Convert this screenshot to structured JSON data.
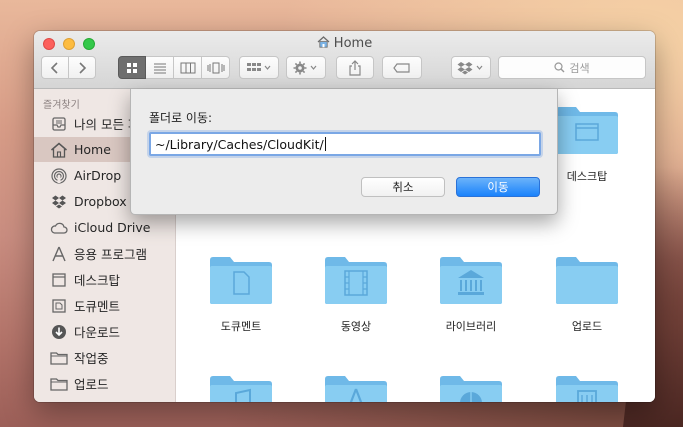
{
  "window": {
    "title": "Home"
  },
  "toolbar": {
    "search_placeholder": "검색",
    "icons": [
      "back-icon",
      "forward-icon",
      "icon-view-icon",
      "list-view-icon",
      "column-view-icon",
      "coverflow-view-icon",
      "arrange-icon",
      "action-gear-icon",
      "share-icon",
      "tag-icon",
      "dropbox-icon",
      "search-icon"
    ]
  },
  "sidebar": {
    "header": "즐겨찾기",
    "items": [
      {
        "label": "나의 모든 파일",
        "icon": "all-files-icon"
      },
      {
        "label": "Home",
        "icon": "home-icon",
        "selected": true
      },
      {
        "label": "AirDrop",
        "icon": "airdrop-icon"
      },
      {
        "label": "Dropbox",
        "icon": "dropbox-icon"
      },
      {
        "label": "iCloud Drive",
        "icon": "cloud-icon"
      },
      {
        "label": "응용 프로그램",
        "icon": "applications-icon"
      },
      {
        "label": "데스크탑",
        "icon": "desktop-icon"
      },
      {
        "label": "도큐멘트",
        "icon": "document-icon"
      },
      {
        "label": "다운로드",
        "icon": "download-icon"
      },
      {
        "label": "작업중",
        "icon": "folder-icon"
      },
      {
        "label": "업로드",
        "icon": "folder-icon"
      }
    ]
  },
  "folders": [
    {
      "label": "데스크탑",
      "icon": "desktop-folder-icon"
    },
    {
      "label": "도큐멘트",
      "icon": "documents-folder-icon"
    },
    {
      "label": "동영상",
      "icon": "movies-folder-icon"
    },
    {
      "label": "라이브러리",
      "icon": "library-folder-icon"
    },
    {
      "label": "업로드",
      "icon": "folder-icon"
    },
    {
      "label": "",
      "icon": "music-folder-icon"
    },
    {
      "label": "",
      "icon": "applications-folder-icon"
    },
    {
      "label": "",
      "icon": "public-folder-icon"
    },
    {
      "label": "",
      "icon": "sites-folder-icon"
    }
  ],
  "dialog": {
    "label": "폴더로 이동:",
    "path_value": "~/Library/Caches/CloudKit/",
    "cancel_label": "취소",
    "go_label": "이동"
  },
  "colors": {
    "folder_blue": "#7cc4ee",
    "accent_blue": "#1a82fb",
    "sidebar_bg": "#efe7e4"
  }
}
